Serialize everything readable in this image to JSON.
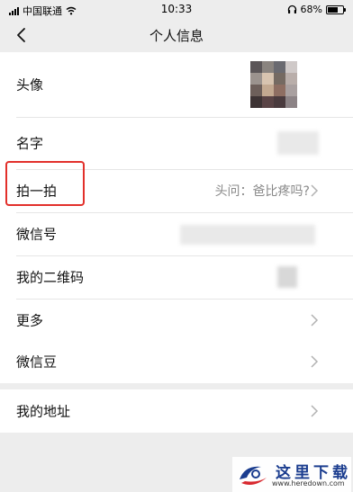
{
  "status_bar": {
    "carrier": "中国联通",
    "time": "10:33",
    "battery": "68%",
    "battery_level": 0.68
  },
  "nav": {
    "title": "个人信息",
    "back_icon": "chevron-left-icon"
  },
  "group1": {
    "rows": [
      {
        "label": "头像"
      },
      {
        "label": "名字"
      },
      {
        "label": "拍一拍",
        "value": "头问：爸比疼吗?"
      },
      {
        "label": "微信号"
      },
      {
        "label": "我的二维码"
      },
      {
        "label": "更多"
      }
    ]
  },
  "group2": {
    "rows": [
      {
        "label": "微信豆"
      }
    ]
  },
  "group3": {
    "rows": [
      {
        "label": "我的地址"
      }
    ]
  },
  "annotation": {
    "color": "#e2302b"
  },
  "watermark": {
    "name": "这里下载",
    "url": "www.heredown.com"
  }
}
